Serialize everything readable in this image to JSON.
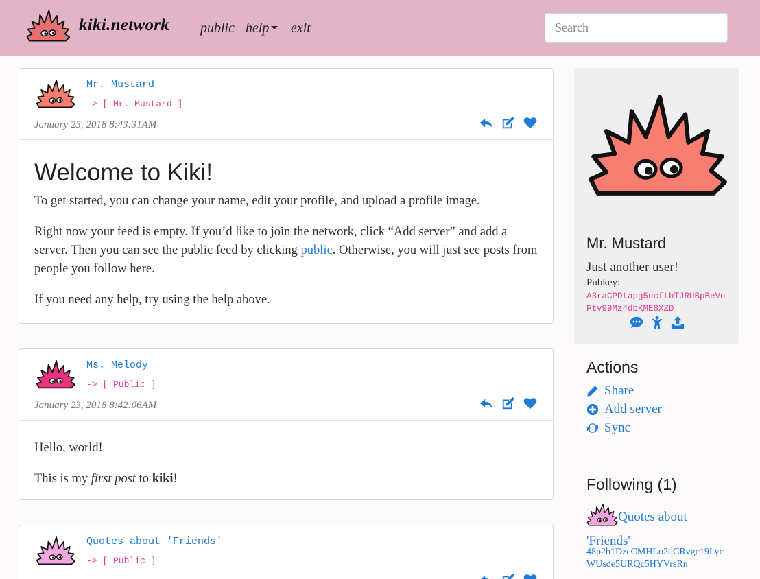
{
  "nav": {
    "brand": "kiki.network",
    "links": {
      "public": "public",
      "help": "help",
      "exit": "exit"
    },
    "search_placeholder": "Search"
  },
  "colors": {
    "navbar": "#e2b4c8",
    "link": "#1e7bd8",
    "accent_pink": "#e83e8c",
    "mr_mustard_avatar": "#f77e70",
    "ms_melody_avatar": "#e8327c",
    "quotes_avatar": "#f4a6e0"
  },
  "posts": [
    {
      "author": "Mr. Mustard",
      "destination": "-> [ Mr. Mustard ]",
      "date": "January 23, 2018 8:43:31AM",
      "heading": "Welcome to Kiki!",
      "paragraphs": [
        "To get started, you can change your name, edit your profile, and upload a profile image.",
        "Right now your feed is empty. If you’d like to join the network, click “Add server” and add a server. Then you can see the public feed by clicking ",
        "public",
        ". Otherwise, you will just see posts from people you follow here.",
        "If you need any help, try using the help above."
      ]
    },
    {
      "author": "Ms. Melody",
      "destination": "-> [ Public ]",
      "date": "January 23, 2018 8:42:06AM",
      "p1": "Hello, world!",
      "p2_a": "This is my ",
      "p2_em": "first post",
      "p2_b": " to ",
      "p2_strong": "kiki",
      "p2_c": "!"
    },
    {
      "author": "Quotes about 'Friends'",
      "destination": "-> [ Public ]"
    }
  ],
  "profile": {
    "name": "Mr. Mustard",
    "bio": "Just another user!",
    "pubkey_label": "Pubkey:",
    "pubkey": "A3raCPDtapg5ucftbTJRUBpBeVnPtv99Mz4dbKME8XZD",
    "icons": [
      "comments-icon",
      "child-icon",
      "upload-icon"
    ]
  },
  "actions": {
    "title": "Actions",
    "items": [
      "Share",
      "Add server",
      "Sync"
    ],
    "icons": [
      "pencil-icon",
      "plus-circle-icon",
      "sync-icon"
    ]
  },
  "following": {
    "title": "Following (1)",
    "name": "Quotes about 'Friends'",
    "key": "48p2b1DzcCMHLo2dCRvgc19LycWUsde5URQc5HYVrsRn"
  }
}
